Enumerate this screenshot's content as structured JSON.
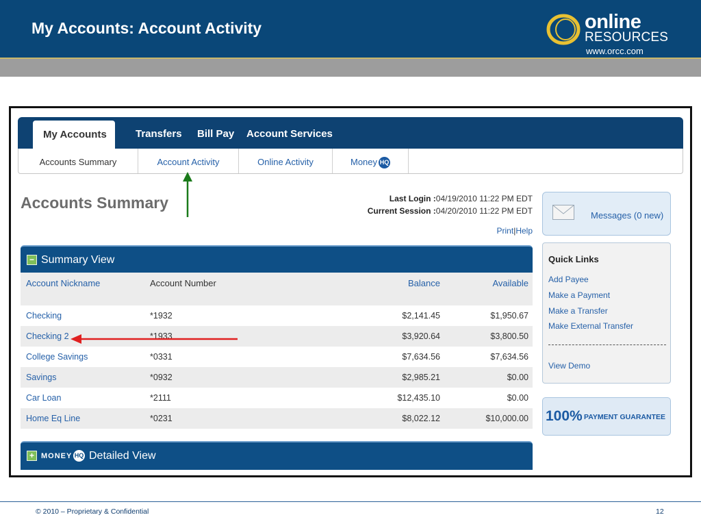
{
  "slide": {
    "title": "My Accounts: Account Activity",
    "footer_copyright": "© 2010 – Proprietary & Confidential",
    "page_number": "12"
  },
  "logo": {
    "word1": "online",
    "word2": "RESOURCES",
    "url": "www.orcc.com"
  },
  "nav": {
    "main_tabs": [
      "My Accounts",
      "Transfers",
      "Bill Pay",
      "Account Services"
    ],
    "active_tab": "My Accounts",
    "sub_tabs": [
      "Accounts Summary",
      "Account Activity",
      "Online Activity",
      "Money"
    ],
    "sub_badge": "HQ"
  },
  "page": {
    "title": "Accounts Summary",
    "last_login_label": "Last Login :",
    "last_login_value": "04/19/2010 11:22 PM EDT",
    "current_session_label": "Current Session :",
    "current_session_value": "04/20/2010 11:22 PM EDT",
    "print": "Print",
    "help": "Help",
    "sep": "|"
  },
  "summary": {
    "title": "Summary View",
    "toggle_symbol": "−",
    "columns": [
      "Account Nickname",
      "Account Number",
      "Balance",
      "Available"
    ],
    "rows": [
      {
        "nickname": "Checking",
        "number": "*1932",
        "balance": "$2,141.45",
        "available": "$1,950.67"
      },
      {
        "nickname": "Checking 2",
        "number": "*1933",
        "balance": "$3,920.64",
        "available": "$3,800.50"
      },
      {
        "nickname": "College Savings",
        "number": "*0331",
        "balance": "$7,634.56",
        "available": "$7,634.56"
      },
      {
        "nickname": "Savings",
        "number": "*0932",
        "balance": "$2,985.21",
        "available": "$0.00"
      },
      {
        "nickname": "Car Loan",
        "number": "*2111",
        "balance": "$12,435.10",
        "available": "$0.00"
      },
      {
        "nickname": "Home Eq Line",
        "number": "*0231",
        "balance": "$8,022.12",
        "available": "$10,000.00"
      }
    ]
  },
  "detail": {
    "toggle_symbol": "+",
    "money": "MONEY",
    "badge": "HQ",
    "title": "Detailed View"
  },
  "sidebar": {
    "messages": "Messages (0 new)",
    "quick_links_title": "Quick Links",
    "quick_links": [
      "Add Payee",
      "Make a Payment",
      "Make a Transfer",
      "Make External Transfer"
    ],
    "view_demo": "View Demo",
    "guarantee_big": "100%",
    "guarantee_small": "PAYMENT GUARANTEE"
  },
  "colors": {
    "header_blue": "#0a4778",
    "link_blue": "#2560a8",
    "arrow_green": "#1a7a1a",
    "arrow_red": "#e02020"
  },
  "icons": [
    "envelope-icon",
    "hq-badge-icon",
    "collapse-icon",
    "expand-icon",
    "logo-ring-icon"
  ]
}
